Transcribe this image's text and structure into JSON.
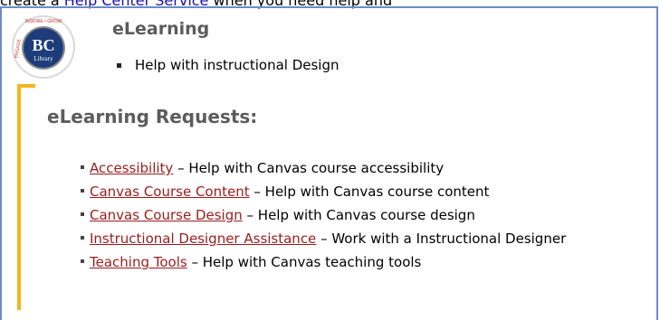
{
  "top_strip": {
    "prefix": "create a ",
    "link": "Help Center Service",
    "suffix": " when you need help and"
  },
  "logo": {
    "ring_text_left": "ENGAGE",
    "ring_text_top": "INSPIRE • GROW",
    "main": "BC",
    "sub": "Library"
  },
  "section": {
    "title": "eLearning",
    "items": [
      "Help with instructional Design"
    ]
  },
  "requests": {
    "title": "eLearning Requests:",
    "items": [
      {
        "link": "Accessibility",
        "desc": " – Help with Canvas course accessibility"
      },
      {
        "link": "Canvas Course Content",
        "desc": " – Help with Canvas course content"
      },
      {
        "link": "Canvas Course Design",
        "desc": " – Help with Canvas course design"
      },
      {
        "link": "Instructional Designer Assistance",
        "desc": " – Work with a Instructional Designer"
      },
      {
        "link": "Teaching Tools",
        "desc": " – Help with Canvas teaching tools"
      }
    ]
  },
  "colors": {
    "link": "#9b1c1c",
    "accent_bar": "#f3b61f",
    "heading": "#5c5c5c",
    "logo_blue": "#1d3d7a"
  }
}
